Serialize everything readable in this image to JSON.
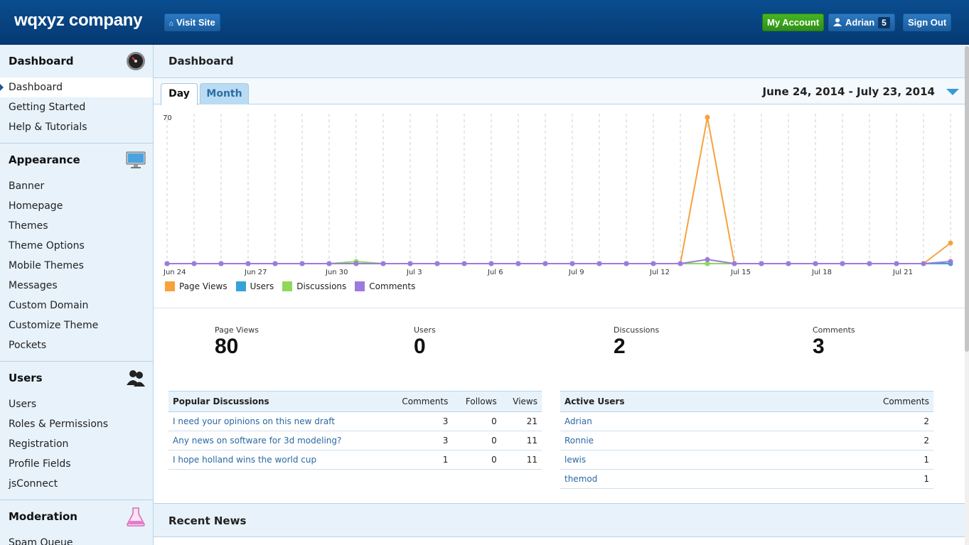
{
  "header": {
    "brand": "wqxyz company",
    "visit_site": "Visit Site",
    "my_account": "My Account",
    "user_name": "Adrian",
    "user_count": "5",
    "sign_out": "Sign Out"
  },
  "sidebar": {
    "dashboard": {
      "title": "Dashboard",
      "items": [
        "Dashboard",
        "Getting Started",
        "Help & Tutorials"
      ]
    },
    "appearance": {
      "title": "Appearance",
      "items": [
        "Banner",
        "Homepage",
        "Themes",
        "Theme Options",
        "Mobile Themes",
        "Messages",
        "Custom Domain",
        "Customize Theme",
        "Pockets"
      ]
    },
    "users": {
      "title": "Users",
      "items": [
        "Users",
        "Roles & Permissions",
        "Registration",
        "Profile Fields",
        "jsConnect"
      ]
    },
    "moderation": {
      "title": "Moderation",
      "items": [
        "Spam Queue"
      ]
    }
  },
  "main": {
    "title": "Dashboard",
    "tabs": {
      "day": "Day",
      "month": "Month"
    },
    "date_range": "June 24, 2014 - July 23, 2014"
  },
  "chart_data": {
    "type": "line",
    "y_tick": "70",
    "ylim": [
      0,
      70
    ],
    "x": [
      "Jun 24",
      "Jun 25",
      "Jun 26",
      "Jun 27",
      "Jun 28",
      "Jun 29",
      "Jun 30",
      "Jul 1",
      "Jul 2",
      "Jul 3",
      "Jul 4",
      "Jul 5",
      "Jul 6",
      "Jul 7",
      "Jul 8",
      "Jul 9",
      "Jul 10",
      "Jul 11",
      "Jul 12",
      "Jul 13",
      "Jul 14",
      "Jul 15",
      "Jul 16",
      "Jul 17",
      "Jul 18",
      "Jul 19",
      "Jul 20",
      "Jul 21",
      "Jul 22",
      "Jul 23"
    ],
    "x_tick_labels": [
      "Jun 24",
      "Jun 27",
      "Jun 30",
      "Jul 3",
      "Jul 6",
      "Jul 9",
      "Jul 12",
      "Jul 15",
      "Jul 18",
      "Jul 21"
    ],
    "series": [
      {
        "name": "Page Views",
        "color": "#f7a23b",
        "values": [
          0,
          0,
          0,
          0,
          0,
          0,
          0,
          0,
          0,
          0,
          0,
          0,
          0,
          0,
          0,
          0,
          0,
          0,
          0,
          0,
          71,
          0,
          0,
          0,
          0,
          0,
          0,
          0,
          0,
          10
        ]
      },
      {
        "name": "Users",
        "color": "#35a3d9",
        "values": [
          0,
          0,
          0,
          0,
          0,
          0,
          0,
          0,
          0,
          0,
          0,
          0,
          0,
          0,
          0,
          0,
          0,
          0,
          0,
          0,
          0,
          0,
          0,
          0,
          0,
          0,
          0,
          0,
          0,
          0
        ]
      },
      {
        "name": "Discussions",
        "color": "#8fd85a",
        "values": [
          0,
          0,
          0,
          0,
          0,
          0,
          0,
          1,
          0,
          0,
          0,
          0,
          0,
          0,
          0,
          0,
          0,
          0,
          0,
          0,
          0,
          0,
          0,
          0,
          0,
          0,
          0,
          0,
          0,
          1
        ]
      },
      {
        "name": "Comments",
        "color": "#9d7ae0",
        "values": [
          0,
          0,
          0,
          0,
          0,
          0,
          0,
          0,
          0,
          0,
          0,
          0,
          0,
          0,
          0,
          0,
          0,
          0,
          0,
          0,
          2,
          0,
          0,
          0,
          0,
          0,
          0,
          0,
          0,
          1
        ]
      }
    ]
  },
  "stats": [
    {
      "label": "Page Views",
      "value": "80"
    },
    {
      "label": "Users",
      "value": "0"
    },
    {
      "label": "Discussions",
      "value": "2"
    },
    {
      "label": "Comments",
      "value": "3"
    }
  ],
  "popular_discussions": {
    "headers": [
      "Popular Discussions",
      "Comments",
      "Follows",
      "Views"
    ],
    "rows": [
      [
        "I need your opinions on this new draft",
        "3",
        "0",
        "21"
      ],
      [
        "Any news on software for 3d modeling?",
        "3",
        "0",
        "11"
      ],
      [
        "I hope holland wins the world cup",
        "1",
        "0",
        "11"
      ]
    ]
  },
  "active_users": {
    "headers": [
      "Active Users",
      "Comments"
    ],
    "rows": [
      [
        "Adrian",
        "2"
      ],
      [
        "Ronnie",
        "2"
      ],
      [
        "lewis",
        "1"
      ],
      [
        "themod",
        "1"
      ]
    ]
  },
  "recent_news": "Recent News"
}
